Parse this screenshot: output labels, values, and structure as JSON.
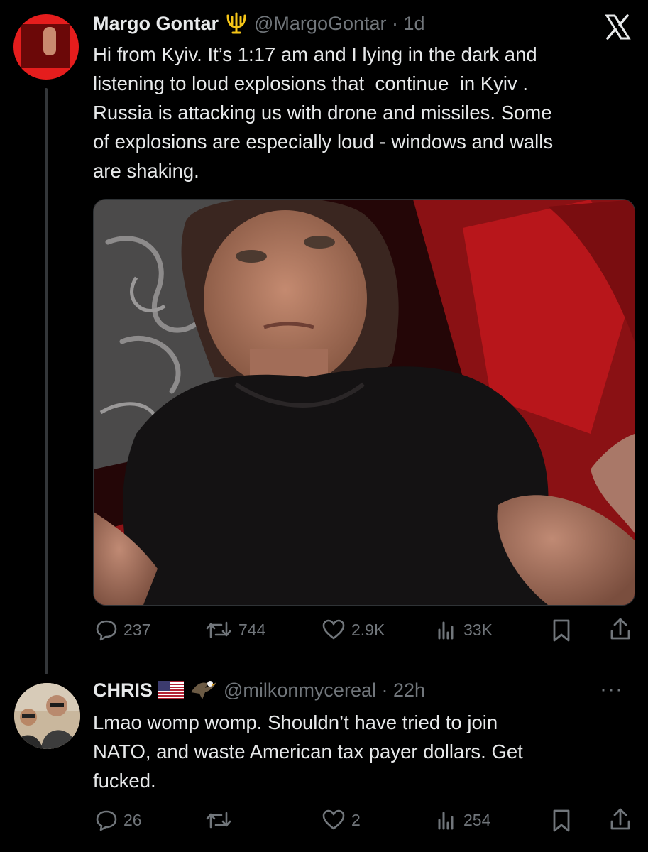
{
  "main_tweet": {
    "author_name": "Margo Gontar",
    "author_badge": "trident-icon",
    "handle_time": "@MargoGontar · 1d",
    "text": "Hi from Kyiv. It’s 1:17 am and I lying in the dark and\nlistening to loud explosions that  continue  in Kyiv .\nRussia is attacking us with drone and missiles. Some\nof explosions are especially loud - windows and walls\nare shaking.",
    "stats": {
      "replies": "237",
      "reposts": "744",
      "likes": "2.9K",
      "views": "33K"
    }
  },
  "reply": {
    "author_name": "CHRIS",
    "author_badges": [
      "us-flag-icon",
      "eagle-icon"
    ],
    "handle_time": "@milkonmycereal · 22h",
    "text": "Lmao womp womp. Shouldn’t have tried to join\nNATO, and waste American tax payer dollars. Get\nfucked.",
    "stats": {
      "replies": "26",
      "reposts": "",
      "likes": "2",
      "views": "254"
    }
  },
  "colors": {
    "background": "#000000",
    "text_primary": "#e7e9ea",
    "text_secondary": "#71767b",
    "accent_badge": "#f5c518"
  }
}
